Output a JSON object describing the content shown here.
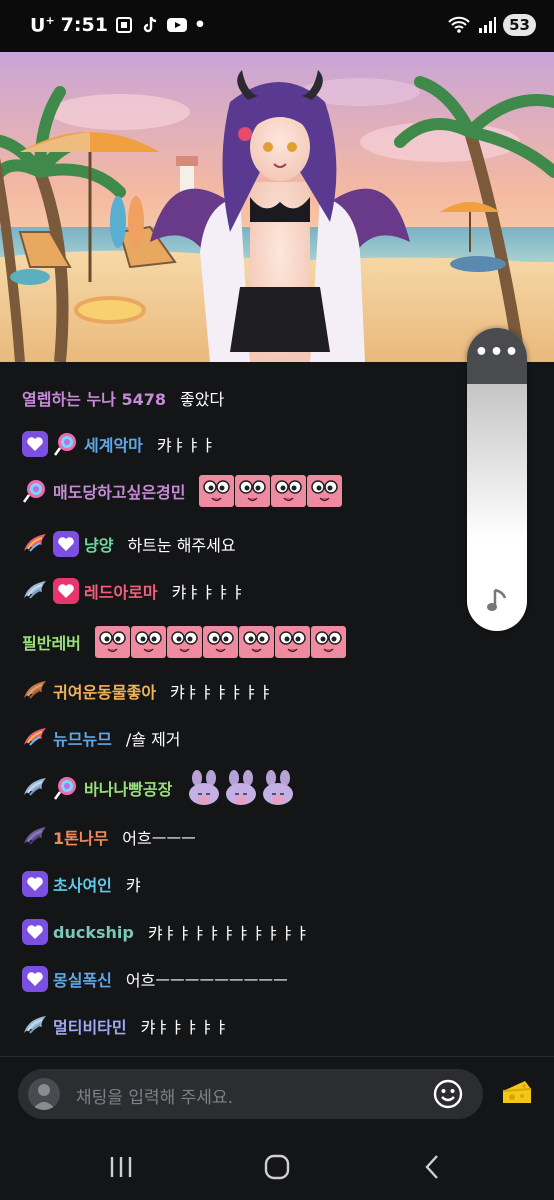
{
  "status_bar": {
    "carrier": "U",
    "carrier_sup": "+",
    "time": "7:51",
    "dot": "•",
    "battery": "53",
    "icons": [
      "screenshot-icon",
      "tiktok-icon",
      "youtube-icon",
      "wifi-icon",
      "signal-icon"
    ]
  },
  "video": {
    "icons": [
      "more-options-icon",
      "music-note-icon"
    ],
    "more_label": "•••"
  },
  "chat": {
    "messages": [
      {
        "nick": "열렙하는 누나 5478",
        "nick_color": "#c78ad6",
        "text": "좋았다",
        "badges": []
      },
      {
        "nick": "세계악마",
        "nick_color": "#5fa8e8",
        "text": "캬ㅑㅑㅑ",
        "badges": [
          "subscriber-heart-badge",
          "lollipop-badge"
        ]
      },
      {
        "nick": "매도당하고싶은경민",
        "nick_color": "#c78ad6",
        "text": "",
        "badges": [
          "lollipop-badge"
        ],
        "emotes": 4
      },
      {
        "nick": "냥양",
        "nick_color": "#6ed6a0",
        "text": "하트눈 해주세요",
        "badges": [
          "rainbow-wing-badge",
          "subscriber-heart-badge"
        ]
      },
      {
        "nick": "레드아로마",
        "nick_color": "#f0607a",
        "text": "캬ㅑㅑㅑㅑ",
        "badges": [
          "silver-wing-badge",
          "pink-heart-badge"
        ]
      },
      {
        "nick": "필반레버",
        "nick_color": "#9ae07a",
        "text": "",
        "badges": [],
        "emotes": 7
      },
      {
        "nick": "귀여운동물좋아",
        "nick_color": "#f0b35a",
        "text": "캬ㅑㅑㅑㅑㅑㅑ",
        "badges": [
          "bronze-wing-badge"
        ]
      },
      {
        "nick": "뉴므뉴므",
        "nick_color": "#5fa8e8",
        "text": "/숄 제거",
        "badges": [
          "rainbow-wing-badge"
        ]
      },
      {
        "nick": "바나나빵공장",
        "nick_color": "#9ae07a",
        "text": "",
        "badges": [
          "silver-wing-badge",
          "lollipop-badge"
        ],
        "bunnies": 3
      },
      {
        "nick": "1톤나무",
        "nick_color": "#f08a5a",
        "text": "어흐ㅡㅡㅡ",
        "badges": [
          "purple-wing-badge"
        ]
      },
      {
        "nick": "초사여인",
        "nick_color": "#5fc8e8",
        "text": "캬",
        "badges": [
          "subscriber-heart-badge"
        ]
      },
      {
        "nick": "duckship",
        "nick_color": "#7ac8b8",
        "text": "캬ㅑㅑㅑㅑㅑㅑㅑㅑㅑㅑ",
        "badges": [
          "subscriber-heart-badge"
        ]
      },
      {
        "nick": "몽실폭신",
        "nick_color": "#5fa8e8",
        "text": "어흐ㅡㅡㅡㅡㅡㅡㅡㅡㅡ",
        "badges": [
          "subscriber-heart-badge"
        ]
      },
      {
        "nick": "멀티비타민",
        "nick_color": "#a0a8f0",
        "text": "캬ㅑㅑㅑㅑㅑ",
        "badges": [
          "silver-wing-badge"
        ]
      }
    ]
  },
  "input": {
    "placeholder": "채팅을 입력해 주세요.",
    "icons": [
      "user-avatar-icon",
      "emoji-icon",
      "cheese-icon"
    ]
  },
  "nav": {
    "icons": [
      "recent-apps-icon",
      "home-icon",
      "back-icon"
    ]
  }
}
